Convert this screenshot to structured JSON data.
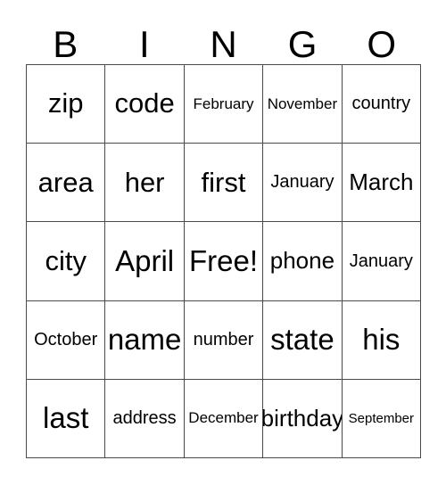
{
  "card": {
    "header": {
      "letters": [
        "B",
        "I",
        "N",
        "G",
        "O"
      ]
    },
    "grid": {
      "rows": [
        {
          "cells": [
            {
              "text": "zip",
              "size": "fs-lg"
            },
            {
              "text": "code",
              "size": "fs-lg"
            },
            {
              "text": "February",
              "size": "fs-xs"
            },
            {
              "text": "November",
              "size": "fs-xs"
            },
            {
              "text": "country",
              "size": "fs-sm"
            }
          ]
        },
        {
          "cells": [
            {
              "text": "area",
              "size": "fs-lg"
            },
            {
              "text": "her",
              "size": "fs-lg"
            },
            {
              "text": "first",
              "size": "fs-lg"
            },
            {
              "text": "January",
              "size": "fs-sm"
            },
            {
              "text": "March",
              "size": "fs-md"
            }
          ]
        },
        {
          "cells": [
            {
              "text": "city",
              "size": "fs-lg"
            },
            {
              "text": "April",
              "size": "fs-xl"
            },
            {
              "text": "Free!",
              "size": "fs-xl"
            },
            {
              "text": "phone",
              "size": "fs-md"
            },
            {
              "text": "January",
              "size": "fs-sm"
            }
          ]
        },
        {
          "cells": [
            {
              "text": "October",
              "size": "fs-sm"
            },
            {
              "text": "name",
              "size": "fs-xl"
            },
            {
              "text": "number",
              "size": "fs-sm"
            },
            {
              "text": "state",
              "size": "fs-xl"
            },
            {
              "text": "his",
              "size": "fs-xl"
            }
          ]
        },
        {
          "cells": [
            {
              "text": "last",
              "size": "fs-xl"
            },
            {
              "text": "address",
              "size": "fs-sm"
            },
            {
              "text": "December",
              "size": "fs-xs"
            },
            {
              "text": "birthday",
              "size": "fs-md"
            },
            {
              "text": "September",
              "size": "fs-xxs"
            }
          ]
        }
      ]
    }
  }
}
